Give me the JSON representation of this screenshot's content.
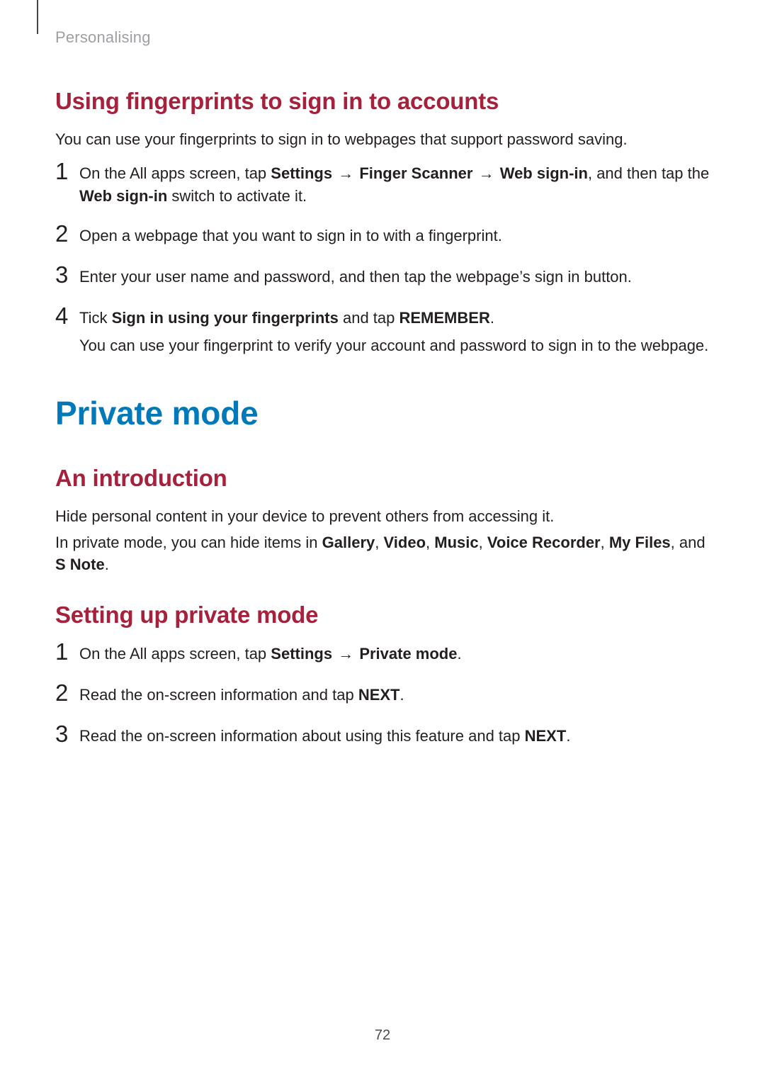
{
  "section_header": "Personalising",
  "sec1": {
    "heading": "Using fingerprints to sign in to accounts",
    "intro": "You can use your fingerprints to sign in to webpages that support password saving.",
    "steps": {
      "s1_num": "1",
      "s1_a": "On the All apps screen, tap ",
      "s1_settings": "Settings",
      "s1_arrow1": " → ",
      "s1_finger": "Finger Scanner",
      "s1_arrow2": " → ",
      "s1_websignin": "Web sign-in",
      "s1_b": ", and then tap the ",
      "s1_websignin2": "Web sign-in",
      "s1_c": " switch to activate it.",
      "s2_num": "2",
      "s2": "Open a webpage that you want to sign in to with a fingerprint.",
      "s3_num": "3",
      "s3": "Enter your user name and password, and then tap the webpage’s sign in button.",
      "s4_num": "4",
      "s4_a": "Tick ",
      "s4_sign": "Sign in using your fingerprints",
      "s4_b": " and tap ",
      "s4_remember": "REMEMBER",
      "s4_c": ".",
      "s4_note": "You can use your fingerprint to verify your account and password to sign in to the webpage."
    }
  },
  "h1": "Private mode",
  "sec2": {
    "heading": "An introduction",
    "p1": "Hide personal content in your device to prevent others from accessing it.",
    "p2_a": "In private mode, you can hide items in ",
    "p2_gallery": "Gallery",
    "p2_sep1": ", ",
    "p2_video": "Video",
    "p2_sep2": ", ",
    "p2_music": "Music",
    "p2_sep3": ", ",
    "p2_voice": "Voice Recorder",
    "p2_sep4": ", ",
    "p2_myfiles": "My Files",
    "p2_sep5": ", and ",
    "p2_snote": "S Note",
    "p2_c": "."
  },
  "sec3": {
    "heading": "Setting up private mode",
    "steps": {
      "s1_num": "1",
      "s1_a": "On the All apps screen, tap ",
      "s1_settings": "Settings",
      "s1_arrow": " → ",
      "s1_private": "Private mode",
      "s1_c": ".",
      "s2_num": "2",
      "s2_a": "Read the on-screen information and tap ",
      "s2_next": "NEXT",
      "s2_c": ".",
      "s3_num": "3",
      "s3_a": "Read the on-screen information about using this feature and tap ",
      "s3_next": "NEXT",
      "s3_c": "."
    }
  },
  "page_number": "72"
}
